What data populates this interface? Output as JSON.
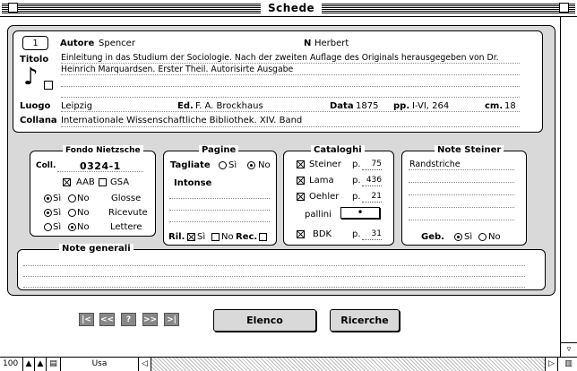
{
  "window": {
    "title": "Schede"
  },
  "record": {
    "number": "1",
    "autore_label": "Autore",
    "autore": "Spencer",
    "n_label": "N",
    "n": "Herbert",
    "titolo_label": "Titolo",
    "titolo_line1": "Einleitung in das Studium der Sociologie. Nach der zweiten Auflage des Originals herausgegeben von Dr.",
    "titolo_line2": "Heinrich Marquardsen. Erster Theil. Autorisirte Ausgabe",
    "luogo_label": "Luogo",
    "luogo": "Leipzig",
    "ed_label": "Ed.",
    "ed": "F. A. Brockhaus",
    "data_label": "Data",
    "data": "1875",
    "pp_label": "pp.",
    "pp": "I-VI, 264",
    "cm_label": "cm.",
    "cm": "18",
    "collana_label": "Collana",
    "collana": "Internationale Wissenschaftliche Bibliothek. XIV. Band"
  },
  "fondo": {
    "title": "Fondo Nietzsche",
    "coll_label": "Coll.",
    "coll": "0324-1",
    "aab_label": "AAB",
    "aab": true,
    "gsa_label": "GSA",
    "gsa": false,
    "si_label": "Sì",
    "no_label": "No",
    "glosse_label": "Glosse",
    "glosse": "si",
    "ricevute_label": "Ricevute",
    "ricevute": "si",
    "lettere_label": "Lettere",
    "lettere": "no"
  },
  "pagine": {
    "title": "Pagine",
    "tagliate_label": "Tagliate",
    "tagliate": "no",
    "si_label": "Sì",
    "no_label": "No",
    "intonse_label": "Intonse",
    "ril_label": "Ril.",
    "ril_si_label": "Sì",
    "ril_si": true,
    "ril_no_label": "No",
    "ril_no": false,
    "rec_label": "Rec.",
    "rec": false
  },
  "cataloghi": {
    "title": "Cataloghi",
    "items": [
      {
        "label": "Steiner",
        "checked": true,
        "p": "75"
      },
      {
        "label": "Lama",
        "checked": true,
        "p": "436"
      },
      {
        "label": "Oehler",
        "checked": true,
        "p": "21"
      }
    ],
    "p_label": "p.",
    "pallini_label": "pallini",
    "pallini_value": "•",
    "bdk_label": "BDK",
    "bdk_checked": true,
    "bdk_p": "31"
  },
  "note_steiner": {
    "title": "Note Steiner",
    "text": "Randstriche",
    "geb_label": "Geb.",
    "geb": "si",
    "si_label": "Sì",
    "no_label": "No"
  },
  "note_generali": {
    "title": "Note generali"
  },
  "nav": {
    "first": "|<",
    "prev": "<<",
    "help": "?",
    "next": ">>",
    "last": ">|"
  },
  "buttons": {
    "elenco": "Elenco",
    "ricerche": "Ricerche"
  },
  "status": {
    "zoom": "100",
    "mode": "Usa"
  }
}
